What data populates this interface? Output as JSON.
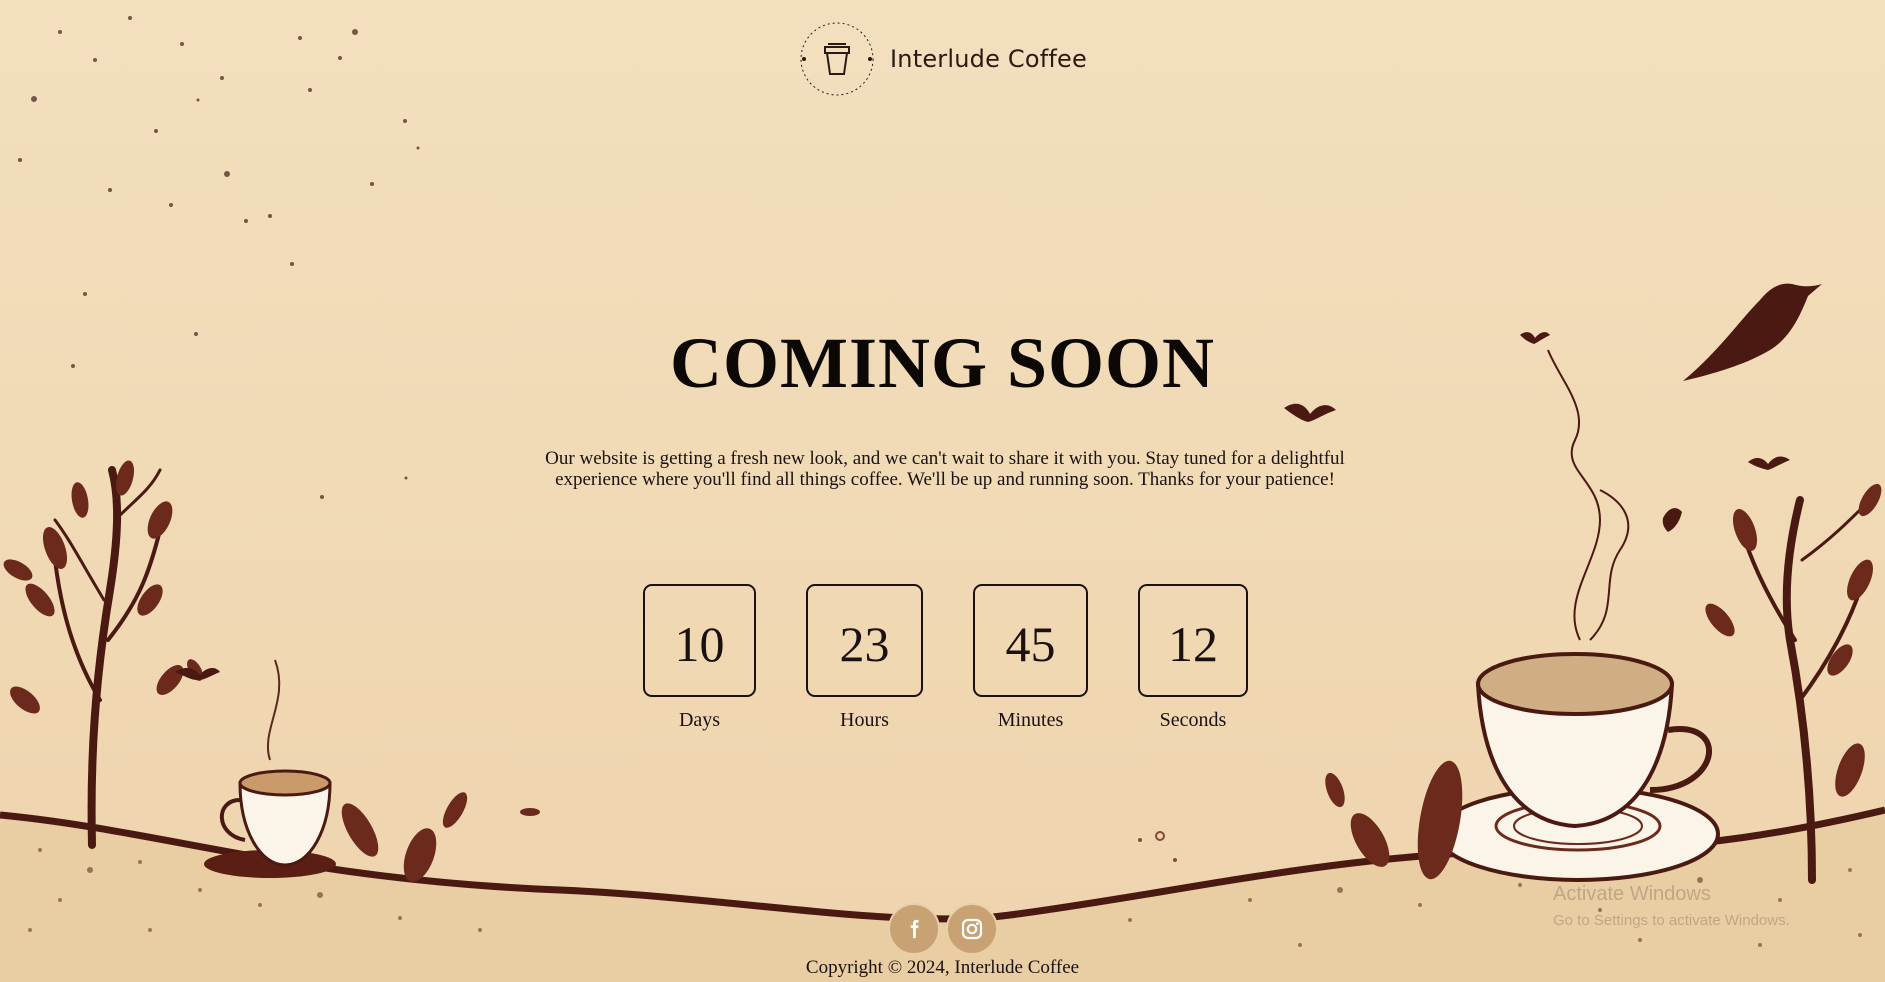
{
  "brand": {
    "name": "Interlude Coffee",
    "badge_text": "Interlude Coffee"
  },
  "hero": {
    "title": "COMING SOON",
    "message": "Our website is getting a fresh new look, and we can't wait to share it with you. Stay tuned for a delightful experience where you'll find all things coffee. We'll be up and running soon. Thanks for your patience!"
  },
  "countdown": [
    {
      "value": "10",
      "label": "Days"
    },
    {
      "value": "23",
      "label": "Hours"
    },
    {
      "value": "45",
      "label": "Minutes"
    },
    {
      "value": "12",
      "label": "Seconds"
    }
  ],
  "social": [
    {
      "icon": "facebook-icon"
    },
    {
      "icon": "instagram-icon"
    }
  ],
  "footer": {
    "copyright": "Copyright © 2024, Interlude Coffee"
  },
  "watermark": {
    "line1": "Activate Windows",
    "line2": "Go to Settings to activate Windows."
  },
  "colors": {
    "background": "#f2dcb9",
    "ink": "#1a1210",
    "illustration": "#5a1e14",
    "social_button": "#c9a274"
  }
}
